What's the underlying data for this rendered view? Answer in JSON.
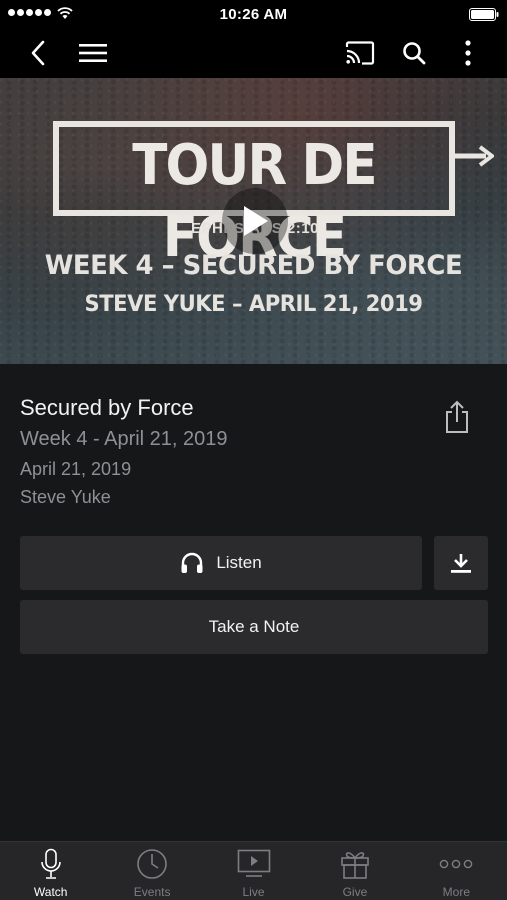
{
  "status_bar": {
    "time": "10:26 AM"
  },
  "nav": {
    "icons": [
      "back-icon",
      "menu-icon",
      "cast-icon",
      "search-icon",
      "more-vertical-icon"
    ]
  },
  "hero": {
    "title": "TOUR DE FORCE",
    "verse": "EPHESIANS 2:10",
    "line1": "WEEK 4 – SECURED BY FORCE",
    "line2": "STEVE YUKE – APRIL 21, 2019"
  },
  "media": {
    "title": "Secured by Force",
    "subtitle": "Week 4 - April 21, 2019",
    "date": "April 21, 2019",
    "speaker": "Steve Yuke"
  },
  "actions": {
    "listen_label": "Listen",
    "note_label": "Take a Note"
  },
  "tabs": [
    {
      "label": "Watch",
      "icon": "microphone-icon",
      "active": true
    },
    {
      "label": "Events",
      "icon": "clock-icon",
      "active": false
    },
    {
      "label": "Live",
      "icon": "tv-play-icon",
      "active": false
    },
    {
      "label": "Give",
      "icon": "gift-icon",
      "active": false
    },
    {
      "label": "More",
      "icon": "dots-icon",
      "active": false
    }
  ],
  "colors": {
    "background": "#161719",
    "button": "#2b2b2d",
    "tab_bar": "#262628",
    "muted_text": "#8f9094"
  }
}
